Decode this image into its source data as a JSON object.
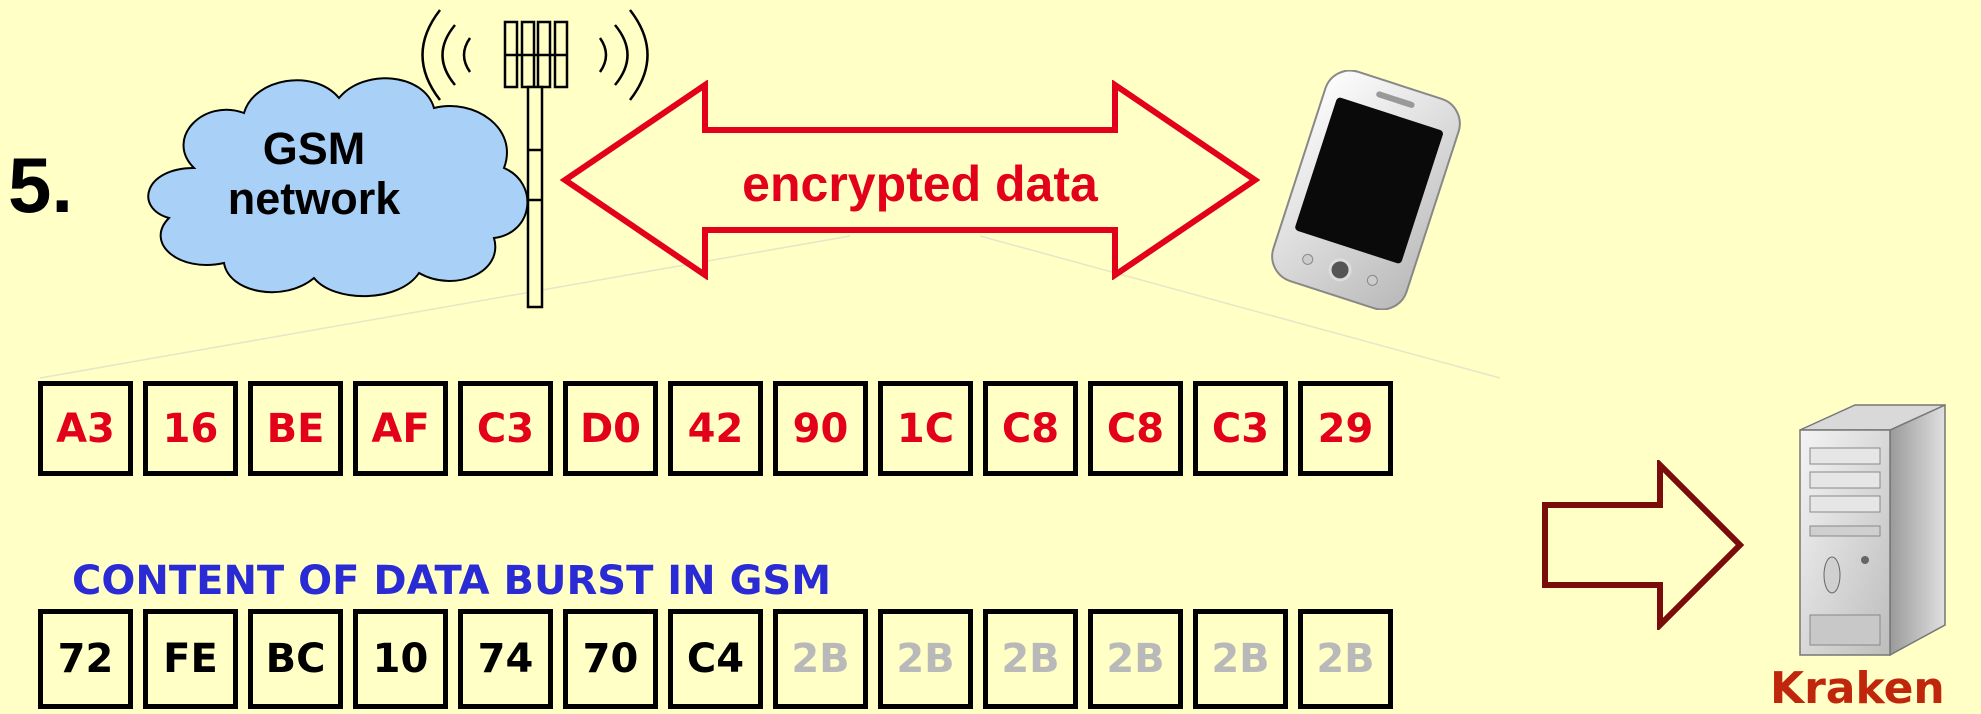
{
  "step_number": "5.",
  "cloud": {
    "line1": "GSM",
    "line2": "network"
  },
  "arrow_label": "encrypted data",
  "encrypted_bytes": [
    "A3",
    "16",
    "BE",
    "AF",
    "C3",
    "D0",
    "42",
    "90",
    "1C",
    "C8",
    "C8",
    "C3",
    "29"
  ],
  "burst_caption": "CONTENT OF DATA BURST IN GSM",
  "plain_bytes": [
    {
      "value": "72",
      "kind": "plain"
    },
    {
      "value": "FE",
      "kind": "plain"
    },
    {
      "value": "BC",
      "kind": "plain"
    },
    {
      "value": "10",
      "kind": "plain"
    },
    {
      "value": "74",
      "kind": "plain"
    },
    {
      "value": "70",
      "kind": "plain"
    },
    {
      "value": "C4",
      "kind": "plain"
    },
    {
      "value": "2B",
      "kind": "pad"
    },
    {
      "value": "2B",
      "kind": "pad"
    },
    {
      "value": "2B",
      "kind": "pad"
    },
    {
      "value": "2B",
      "kind": "pad"
    },
    {
      "value": "2B",
      "kind": "pad"
    },
    {
      "value": "2B",
      "kind": "pad"
    }
  ],
  "server_label": "Kraken",
  "colors": {
    "background": "#ffffc6",
    "encrypted_text": "#e2001a",
    "caption_blue": "#2b2bd6",
    "padding_gray": "#b9b9b9",
    "cloud_fill": "#a9d1f7",
    "kraken_arrow": "#7a0c0c"
  },
  "icons": [
    "cloud-icon",
    "cell-tower-icon",
    "double-arrow-icon",
    "smartphone-icon",
    "right-arrow-icon",
    "server-icon"
  ]
}
